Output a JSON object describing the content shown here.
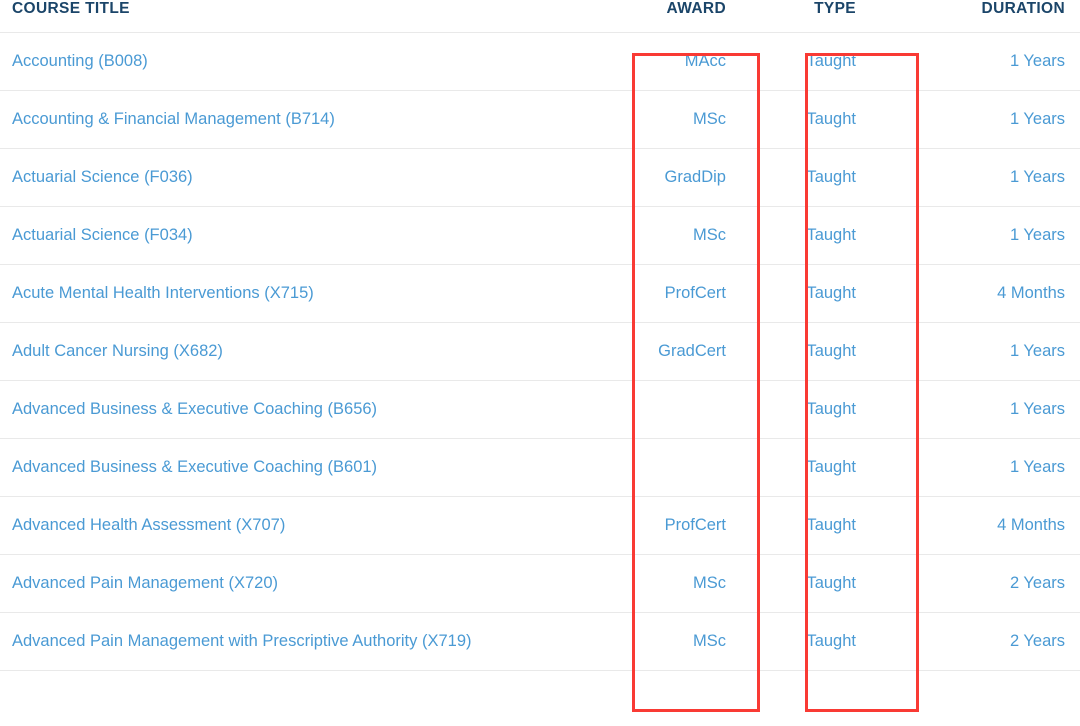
{
  "table": {
    "columns": [
      {
        "key": "title",
        "label": "COURSE TITLE",
        "align": "left"
      },
      {
        "key": "award",
        "label": "AWARD",
        "align": "right"
      },
      {
        "key": "type",
        "label": "TYPE",
        "align": "right"
      },
      {
        "key": "duration",
        "label": "DURATION",
        "align": "right"
      }
    ],
    "rows": [
      {
        "title": "Accounting (B008)",
        "award": "MAcc",
        "type": "Taught",
        "duration": "1 Years"
      },
      {
        "title": "Accounting & Financial Management (B714)",
        "award": "MSc",
        "type": "Taught",
        "duration": "1 Years"
      },
      {
        "title": "Actuarial Science (F036)",
        "award": "GradDip",
        "type": "Taught",
        "duration": "1 Years"
      },
      {
        "title": "Actuarial Science (F034)",
        "award": "MSc",
        "type": "Taught",
        "duration": "1 Years"
      },
      {
        "title": "Acute Mental Health Interventions (X715)",
        "award": "ProfCert",
        "type": "Taught",
        "duration": "4 Months"
      },
      {
        "title": "Adult Cancer Nursing (X682)",
        "award": "GradCert",
        "type": "Taught",
        "duration": "1 Years"
      },
      {
        "title": "Advanced Business & Executive Coaching (B656)",
        "award": "",
        "type": "Taught",
        "duration": "1 Years"
      },
      {
        "title": "Advanced Business & Executive Coaching (B601)",
        "award": "",
        "type": "Taught",
        "duration": "1 Years"
      },
      {
        "title": "Advanced Health Assessment (X707)",
        "award": "ProfCert",
        "type": "Taught",
        "duration": "4 Months"
      },
      {
        "title": "Advanced Pain Management (X720)",
        "award": "MSc",
        "type": "Taught",
        "duration": "2 Years"
      },
      {
        "title": "Advanced Pain Management with Prescriptive Authority (X719)",
        "award": "MSc",
        "type": "Taught",
        "duration": "2 Years"
      }
    ]
  },
  "annotations": [
    {
      "id": "annot-award",
      "target_column": "AWARD",
      "color": "#f93a34"
    },
    {
      "id": "annot-type",
      "target_column": "TYPE",
      "color": "#f93a34"
    }
  ],
  "colors": {
    "header_text": "#1b4569",
    "link_text": "#4a9ad4",
    "row_divider": "#e9e9e9",
    "annotation": "#f93a34",
    "background": "#ffffff"
  }
}
